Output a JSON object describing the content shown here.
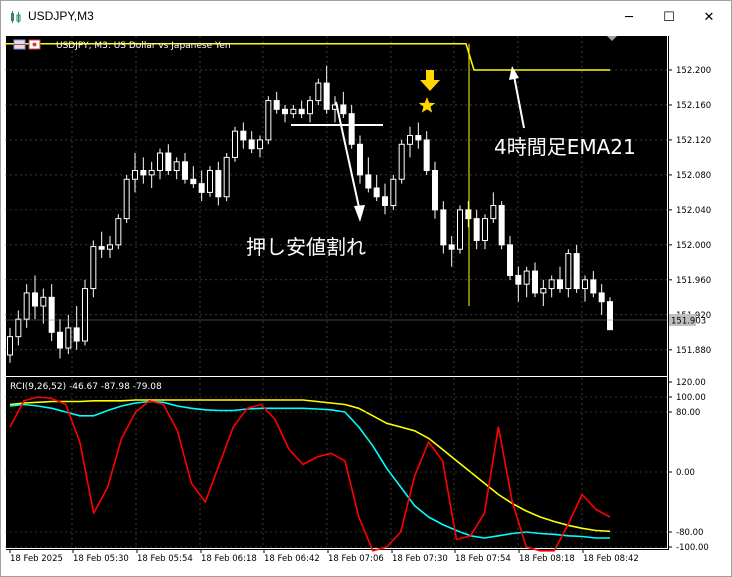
{
  "window": {
    "title": "USDJPY,M3",
    "controls": [
      "minimize-icon",
      "maximize-icon",
      "close-icon"
    ]
  },
  "chart": {
    "header": "USDJPY, M3:  US Dollar vs Japanese Yen",
    "price_axis": [
      "152.200",
      "152.160",
      "152.120",
      "152.080",
      "152.040",
      "152.000",
      "151.960",
      "151.920",
      "151.880"
    ],
    "current_price": "151.903",
    "time_axis": [
      "18 Feb 2025",
      "18 Feb 05:30",
      "18 Feb 05:54",
      "18 Feb 06:18",
      "18 Feb 06:42",
      "18 Feb 07:06",
      "18 Feb 07:30",
      "18 Feb 07:54",
      "18 Feb 08:18",
      "18 Feb 08:42"
    ],
    "annotations": {
      "support_break": "押し安値割れ",
      "ema_label": "4時間足EMA21"
    },
    "colors": {
      "background": "#000000",
      "candle": "#ffffff",
      "ema": "#ffff00",
      "rci_fast": "#ff0000",
      "rci_mid": "#00ffff",
      "rci_slow": "#ffff00",
      "arrow": "#ffd700"
    }
  },
  "indicator": {
    "header": "RCI(9,26,52) -46.67 -87.98 -79.08",
    "axis": [
      "120.00",
      "100.00",
      "80.00",
      "0.00",
      "-80.00",
      "-100.00"
    ]
  },
  "candles": [
    {
      "o": 151.874,
      "h": 151.905,
      "l": 151.865,
      "c": 151.895
    },
    {
      "o": 151.895,
      "h": 151.925,
      "l": 151.885,
      "c": 151.915
    },
    {
      "o": 151.915,
      "h": 151.955,
      "l": 151.905,
      "c": 151.945
    },
    {
      "o": 151.945,
      "h": 151.965,
      "l": 151.915,
      "c": 151.93
    },
    {
      "o": 151.93,
      "h": 151.95,
      "l": 151.91,
      "c": 151.94
    },
    {
      "o": 151.94,
      "h": 151.955,
      "l": 151.89,
      "c": 151.9
    },
    {
      "o": 151.9,
      "h": 151.915,
      "l": 151.87,
      "c": 151.882
    },
    {
      "o": 151.882,
      "h": 151.92,
      "l": 151.875,
      "c": 151.905
    },
    {
      "o": 151.905,
      "h": 151.93,
      "l": 151.88,
      "c": 151.89
    },
    {
      "o": 151.89,
      "h": 151.96,
      "l": 151.885,
      "c": 151.95
    },
    {
      "o": 151.95,
      "h": 152.005,
      "l": 151.94,
      "c": 151.998
    },
    {
      "o": 151.998,
      "h": 152.015,
      "l": 151.985,
      "c": 151.995
    },
    {
      "o": 151.995,
      "h": 152.01,
      "l": 151.985,
      "c": 152.0
    },
    {
      "o": 152.0,
      "h": 152.035,
      "l": 151.995,
      "c": 152.03
    },
    {
      "o": 152.03,
      "h": 152.08,
      "l": 152.025,
      "c": 152.075
    },
    {
      "o": 152.075,
      "h": 152.105,
      "l": 152.06,
      "c": 152.085
    },
    {
      "o": 152.085,
      "h": 152.1,
      "l": 152.07,
      "c": 152.08
    },
    {
      "o": 152.08,
      "h": 152.095,
      "l": 152.065,
      "c": 152.085
    },
    {
      "o": 152.085,
      "h": 152.11,
      "l": 152.075,
      "c": 152.105
    },
    {
      "o": 152.105,
      "h": 152.115,
      "l": 152.08,
      "c": 152.085
    },
    {
      "o": 152.085,
      "h": 152.1,
      "l": 152.075,
      "c": 152.095
    },
    {
      "o": 152.095,
      "h": 152.105,
      "l": 152.07,
      "c": 152.075
    },
    {
      "o": 152.075,
      "h": 152.09,
      "l": 152.065,
      "c": 152.07
    },
    {
      "o": 152.07,
      "h": 152.085,
      "l": 152.05,
      "c": 152.06
    },
    {
      "o": 152.06,
      "h": 152.09,
      "l": 152.055,
      "c": 152.085
    },
    {
      "o": 152.085,
      "h": 152.095,
      "l": 152.045,
      "c": 152.055
    },
    {
      "o": 152.055,
      "h": 152.105,
      "l": 152.05,
      "c": 152.1
    },
    {
      "o": 152.1,
      "h": 152.135,
      "l": 152.095,
      "c": 152.13
    },
    {
      "o": 152.13,
      "h": 152.14,
      "l": 152.11,
      "c": 152.12
    },
    {
      "o": 152.12,
      "h": 152.13,
      "l": 152.105,
      "c": 152.11
    },
    {
      "o": 152.11,
      "h": 152.125,
      "l": 152.1,
      "c": 152.12
    },
    {
      "o": 152.12,
      "h": 152.17,
      "l": 152.115,
      "c": 152.165
    },
    {
      "o": 152.165,
      "h": 152.175,
      "l": 152.15,
      "c": 152.155
    },
    {
      "o": 152.155,
      "h": 152.16,
      "l": 152.14,
      "c": 152.15
    },
    {
      "o": 152.15,
      "h": 152.16,
      "l": 152.145,
      "c": 152.155
    },
    {
      "o": 152.155,
      "h": 152.165,
      "l": 152.145,
      "c": 152.15
    },
    {
      "o": 152.15,
      "h": 152.17,
      "l": 152.14,
      "c": 152.165
    },
    {
      "o": 152.165,
      "h": 152.19,
      "l": 152.16,
      "c": 152.185
    },
    {
      "o": 152.185,
      "h": 152.205,
      "l": 152.15,
      "c": 152.155
    },
    {
      "o": 152.155,
      "h": 152.17,
      "l": 152.14,
      "c": 152.16
    },
    {
      "o": 152.16,
      "h": 152.175,
      "l": 152.145,
      "c": 152.15
    },
    {
      "o": 152.15,
      "h": 152.16,
      "l": 152.11,
      "c": 152.115
    },
    {
      "o": 152.115,
      "h": 152.125,
      "l": 152.07,
      "c": 152.08
    },
    {
      "o": 152.08,
      "h": 152.1,
      "l": 152.06,
      "c": 152.065
    },
    {
      "o": 152.065,
      "h": 152.08,
      "l": 152.05,
      "c": 152.055
    },
    {
      "o": 152.055,
      "h": 152.07,
      "l": 152.035,
      "c": 152.045
    },
    {
      "o": 152.045,
      "h": 152.08,
      "l": 152.04,
      "c": 152.075
    },
    {
      "o": 152.075,
      "h": 152.12,
      "l": 152.07,
      "c": 152.115
    },
    {
      "o": 152.115,
      "h": 152.135,
      "l": 152.1,
      "c": 152.125
    },
    {
      "o": 152.125,
      "h": 152.14,
      "l": 152.11,
      "c": 152.12
    },
    {
      "o": 152.12,
      "h": 152.13,
      "l": 152.08,
      "c": 152.085
    },
    {
      "o": 152.085,
      "h": 152.095,
      "l": 152.03,
      "c": 152.04
    },
    {
      "o": 152.04,
      "h": 152.05,
      "l": 151.99,
      "c": 152.0
    },
    {
      "o": 152.0,
      "h": 152.01,
      "l": 151.975,
      "c": 151.995
    },
    {
      "o": 151.995,
      "h": 152.045,
      "l": 151.99,
      "c": 152.04
    },
    {
      "o": 152.04,
      "h": 152.05,
      "l": 152.02,
      "c": 152.03
    },
    {
      "o": 152.03,
      "h": 152.04,
      "l": 151.995,
      "c": 152.005
    },
    {
      "o": 152.005,
      "h": 152.035,
      "l": 151.995,
      "c": 152.03
    },
    {
      "o": 152.03,
      "h": 152.06,
      "l": 152.025,
      "c": 152.045
    },
    {
      "o": 152.045,
      "h": 152.05,
      "l": 151.995,
      "c": 152.0
    },
    {
      "o": 152.0,
      "h": 152.01,
      "l": 151.96,
      "c": 151.965
    },
    {
      "o": 151.965,
      "h": 151.975,
      "l": 151.935,
      "c": 151.955
    },
    {
      "o": 151.955,
      "h": 151.975,
      "l": 151.94,
      "c": 151.97
    },
    {
      "o": 151.97,
      "h": 151.98,
      "l": 151.94,
      "c": 151.945
    },
    {
      "o": 151.945,
      "h": 151.96,
      "l": 151.93,
      "c": 151.95
    },
    {
      "o": 151.95,
      "h": 151.965,
      "l": 151.94,
      "c": 151.96
    },
    {
      "o": 151.96,
      "h": 151.975,
      "l": 151.945,
      "c": 151.95
    },
    {
      "o": 151.95,
      "h": 151.995,
      "l": 151.94,
      "c": 151.99
    },
    {
      "o": 151.99,
      "h": 152.0,
      "l": 151.945,
      "c": 151.95
    },
    {
      "o": 151.95,
      "h": 151.965,
      "l": 151.935,
      "c": 151.96
    },
    {
      "o": 151.96,
      "h": 151.97,
      "l": 151.94,
      "c": 151.945
    },
    {
      "o": 151.945,
      "h": 151.955,
      "l": 151.92,
      "c": 151.935
    },
    {
      "o": 151.935,
      "h": 151.94,
      "l": 151.903,
      "c": 151.903
    }
  ],
  "ema_series": [
    152.23,
    152.23,
    152.23,
    152.23,
    152.23,
    152.2,
    152.2,
    152.2
  ],
  "rci": {
    "fast": [
      60,
      95,
      100,
      98,
      90,
      40,
      -55,
      -20,
      45,
      80,
      95,
      90,
      55,
      -15,
      -40,
      10,
      60,
      85,
      90,
      70,
      30,
      10,
      20,
      25,
      15,
      -60,
      -105,
      -100,
      -80,
      -5,
      40,
      15,
      -90,
      -85,
      -55,
      60,
      -40,
      -100,
      -105,
      -105,
      -70,
      -30,
      -50,
      -60
    ],
    "mid": [
      88,
      90,
      88,
      85,
      80,
      75,
      75,
      82,
      88,
      92,
      94,
      93,
      88,
      85,
      83,
      82,
      82,
      84,
      85,
      85,
      85,
      85,
      84,
      83,
      80,
      60,
      35,
      5,
      -20,
      -45,
      -60,
      -70,
      -78,
      -85,
      -88,
      -85,
      -82,
      -80,
      -82,
      -83,
      -85,
      -86,
      -88,
      -88
    ],
    "slow": [
      90,
      92,
      93,
      94,
      94,
      94,
      95,
      95,
      95,
      96,
      96,
      96,
      96,
      96,
      96,
      96,
      96,
      96,
      96,
      96,
      96,
      96,
      94,
      92,
      90,
      85,
      75,
      65,
      60,
      55,
      45,
      30,
      15,
      0,
      -15,
      -30,
      -42,
      -52,
      -60,
      -66,
      -71,
      -75,
      -78,
      -79
    ]
  }
}
